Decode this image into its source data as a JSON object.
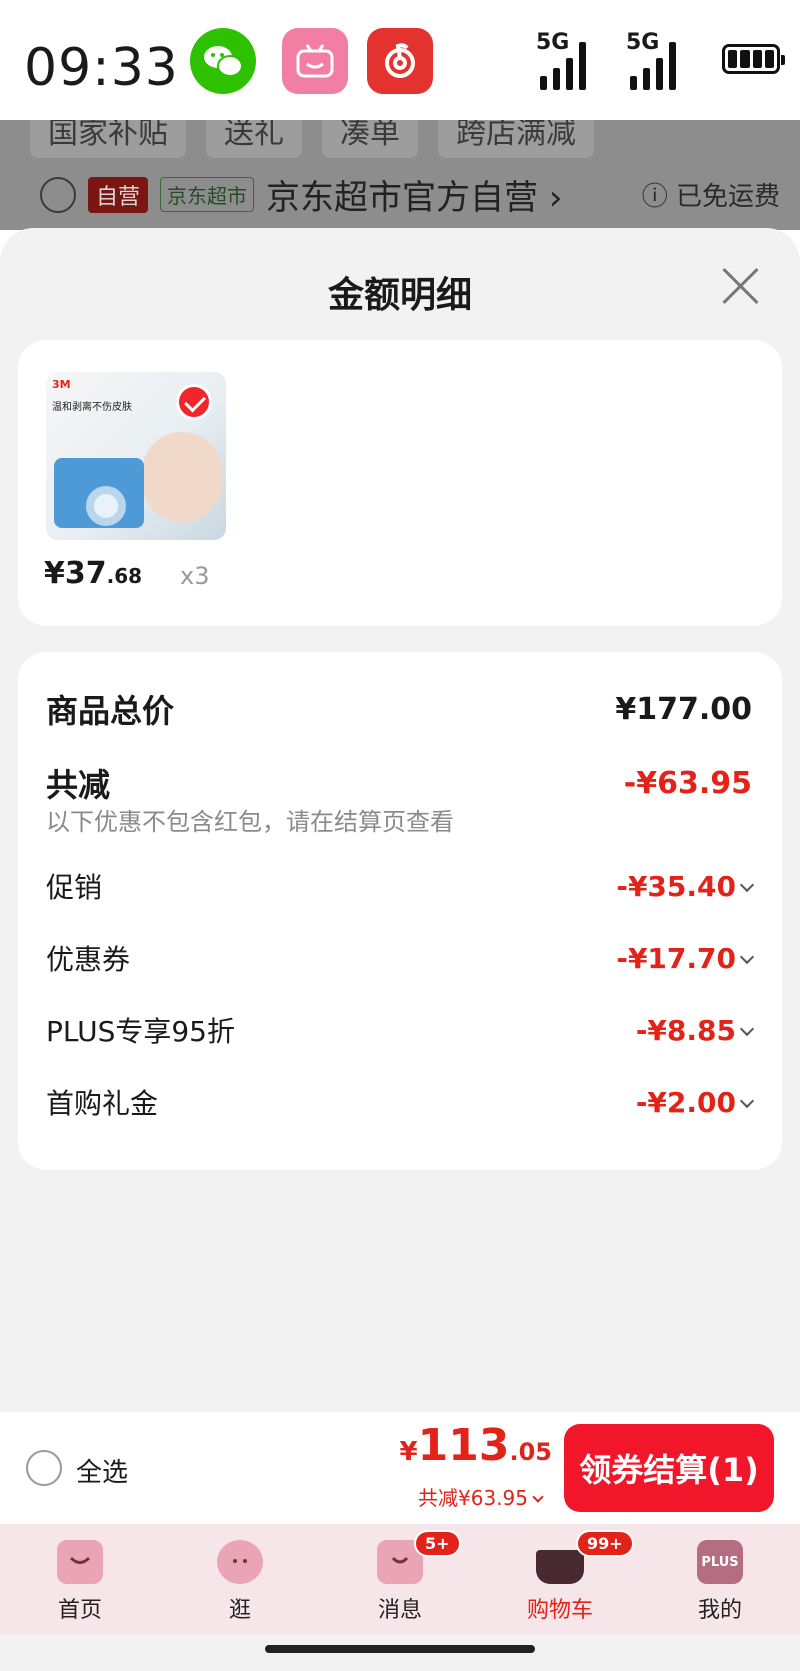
{
  "status_bar": {
    "time": "09:33",
    "network_1": "5G",
    "network_2": "5G",
    "apps": [
      {
        "name": "wechat-app-icon",
        "color": "#2dc100"
      },
      {
        "name": "bilibili-app-icon",
        "color": "#f37ea4"
      },
      {
        "name": "netease-music-app-icon",
        "color": "#e4332e"
      }
    ]
  },
  "background_page": {
    "tabs": [
      "国家补贴",
      "送礼",
      "凑单",
      "跨店满减"
    ],
    "store": {
      "self_tag": "自营",
      "market_tag": "京东超市",
      "name": "京东超市官方自营 ›",
      "free_shipping": "ⓘ 已免运费"
    }
  },
  "sheet": {
    "title": "金额明细",
    "product": {
      "brand": "3M",
      "caption": "温和剥离不伤皮肤",
      "price_int": "¥37",
      "price_dec": ".68",
      "quantity": "x3"
    },
    "summary": {
      "goods_total_label": "商品总价",
      "goods_total_value": "¥177.00",
      "reduction_label": "共减",
      "reduction_value": "-¥63.95",
      "note": "以下优惠不包含红包，请在结算页查看",
      "items": [
        {
          "label": "促销",
          "value": "-¥35.40"
        },
        {
          "label": "优惠券",
          "value": "-¥17.70"
        },
        {
          "label": "PLUS专享95折",
          "value": "-¥8.85"
        },
        {
          "label": "首购礼金",
          "value": "-¥2.00"
        }
      ]
    }
  },
  "checkout_bar": {
    "select_all": "全选",
    "total_currency": "¥",
    "total_int": "113",
    "total_dec": ".05",
    "total_reduction": "共减¥63.95",
    "pay_button": "领券结算(1)"
  },
  "tab_bar": {
    "items": [
      {
        "label": "首页",
        "icon": "home-icon"
      },
      {
        "label": "逛",
        "icon": "planet-icon"
      },
      {
        "label": "消息",
        "icon": "message-icon",
        "badge": "5+"
      },
      {
        "label": "购物车",
        "icon": "cart-icon",
        "badge": "99+",
        "active": true
      },
      {
        "label": "我的",
        "icon": "plus-member-icon",
        "icon_text": "PLUS"
      }
    ]
  },
  "colors": {
    "accent_red": "#e2231a",
    "pay_button": "#f2162a",
    "sheet_bg": "#f2f2f2"
  }
}
